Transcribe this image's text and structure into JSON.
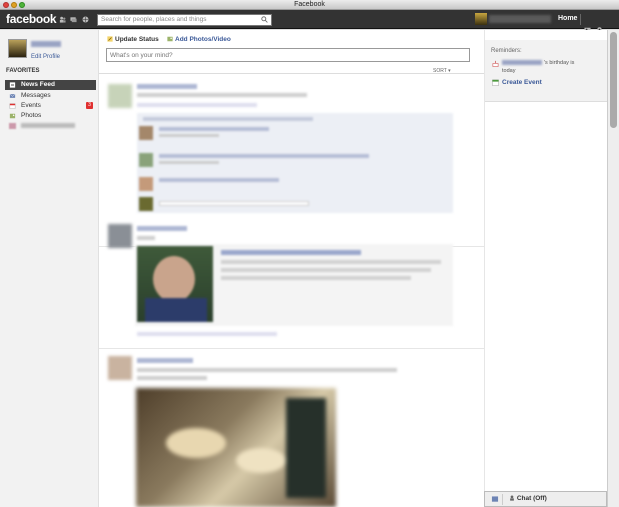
{
  "window": {
    "title": "Facebook"
  },
  "topnav": {
    "logo": "facebook",
    "search_placeholder": "Search for people, places and things",
    "home": "Home"
  },
  "sidebar": {
    "edit_profile": "Edit Profile",
    "favorites_title": "FAVORITES",
    "items": [
      {
        "label": "News Feed",
        "icon": "news-feed-icon"
      },
      {
        "label": "Messages",
        "icon": "messages-icon"
      },
      {
        "label": "Events",
        "icon": "events-icon",
        "badge": "3"
      },
      {
        "label": "Photos",
        "icon": "photos-icon"
      }
    ]
  },
  "composer": {
    "update_status": "Update Status",
    "add_photos": "Add Photos/Video",
    "placeholder": "What's on your mind?",
    "sort": "SORT ▾"
  },
  "reminders": {
    "title": "Reminders:",
    "birthday_text": "'s birthday is",
    "today": "today",
    "create_event": "Create Event"
  },
  "chat": {
    "label": "Chat (Off)"
  },
  "colors": {
    "brand": "#3b5998",
    "topbar": "#333333",
    "badge": "#e03030"
  }
}
